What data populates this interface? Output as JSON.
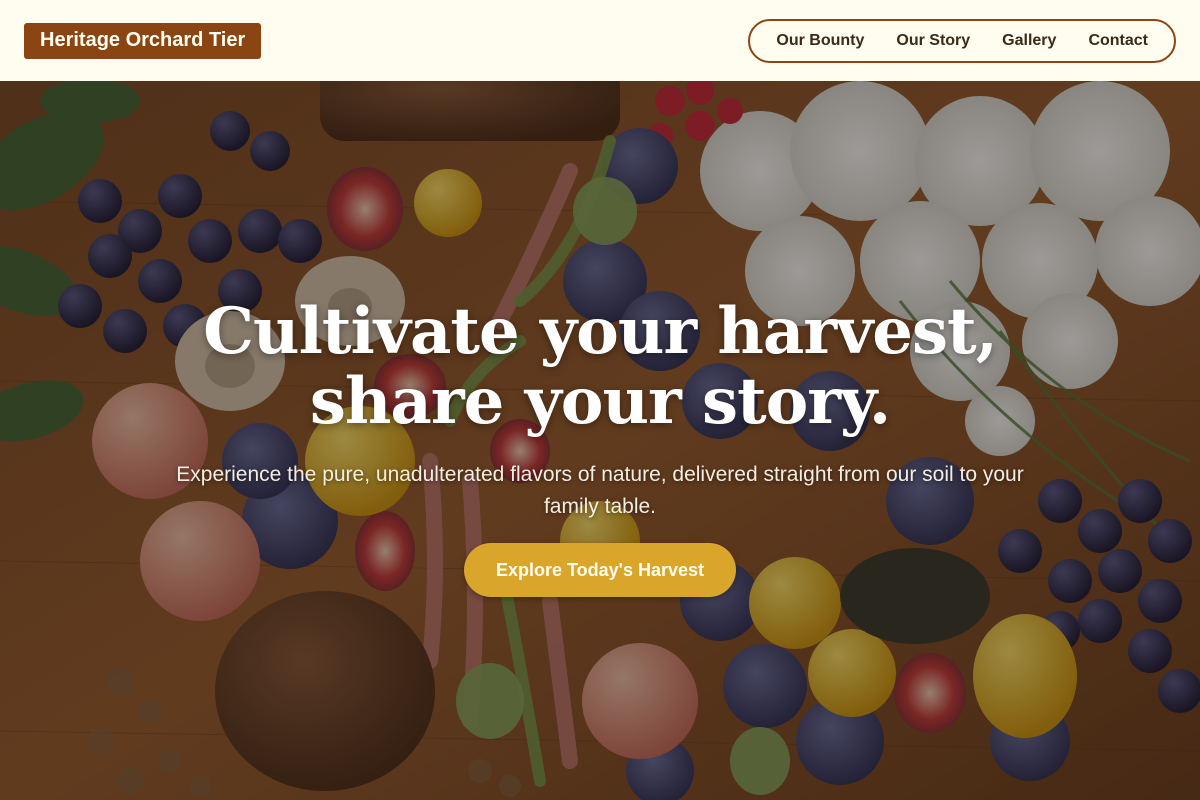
{
  "brand": {
    "name": "Heritage Orchard Tier"
  },
  "nav": {
    "items": [
      {
        "label": "Our Bounty"
      },
      {
        "label": "Our Story"
      },
      {
        "label": "Gallery"
      },
      {
        "label": "Contact"
      }
    ]
  },
  "hero": {
    "title_line1": "Cultivate your harvest,",
    "title_line2": "share your story.",
    "subtitle": "Experience the pure, unadulterated flavors of nature, delivered straight from our soil to your family table.",
    "cta_label": "Explore Today's Harvest"
  },
  "colors": {
    "header_bg": "#fffdf0",
    "brand_accent": "#8b4513",
    "cta": "#d9a52b"
  }
}
